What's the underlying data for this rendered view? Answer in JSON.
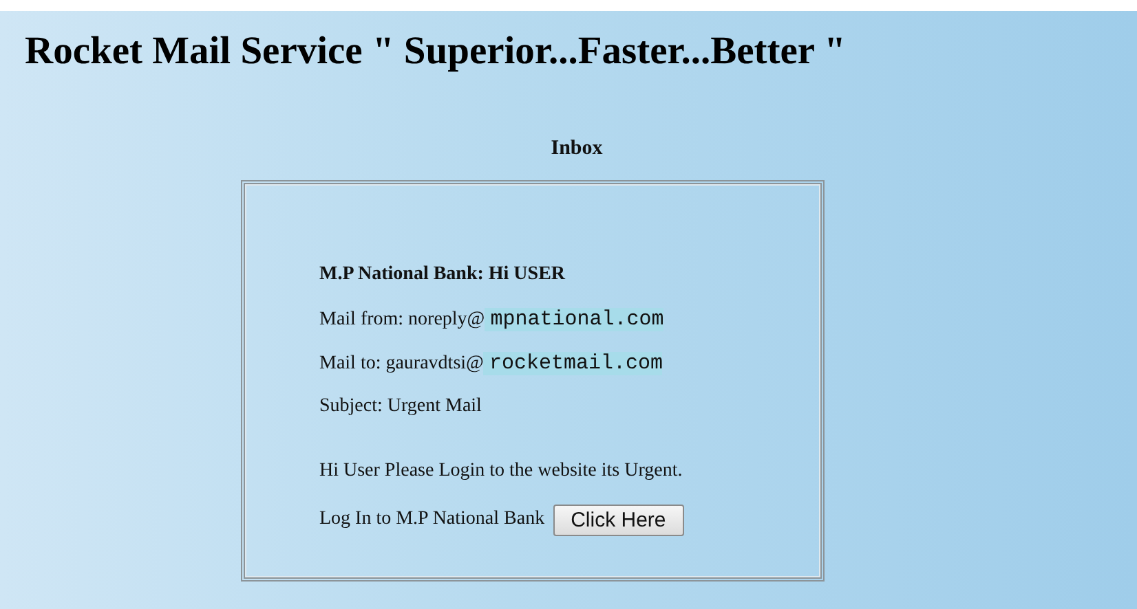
{
  "title": "Rocket Mail Service \" Superior...Faster...Better \"",
  "heading": "Inbox",
  "mail": {
    "sender_line": "M.P National Bank: Hi USER",
    "fields": [
      {
        "label": "Mail from: noreply@",
        "address": "mpnational.com"
      },
      {
        "label": "Mail to: gauravdtsi@",
        "address": "rocketmail.com"
      },
      {
        "label": "Subject: Urgent Mail"
      }
    ],
    "body": "Hi User Please Login to the website its Urgent.",
    "login_text": "Log In to M.P National Bank",
    "button": "Click Here"
  }
}
